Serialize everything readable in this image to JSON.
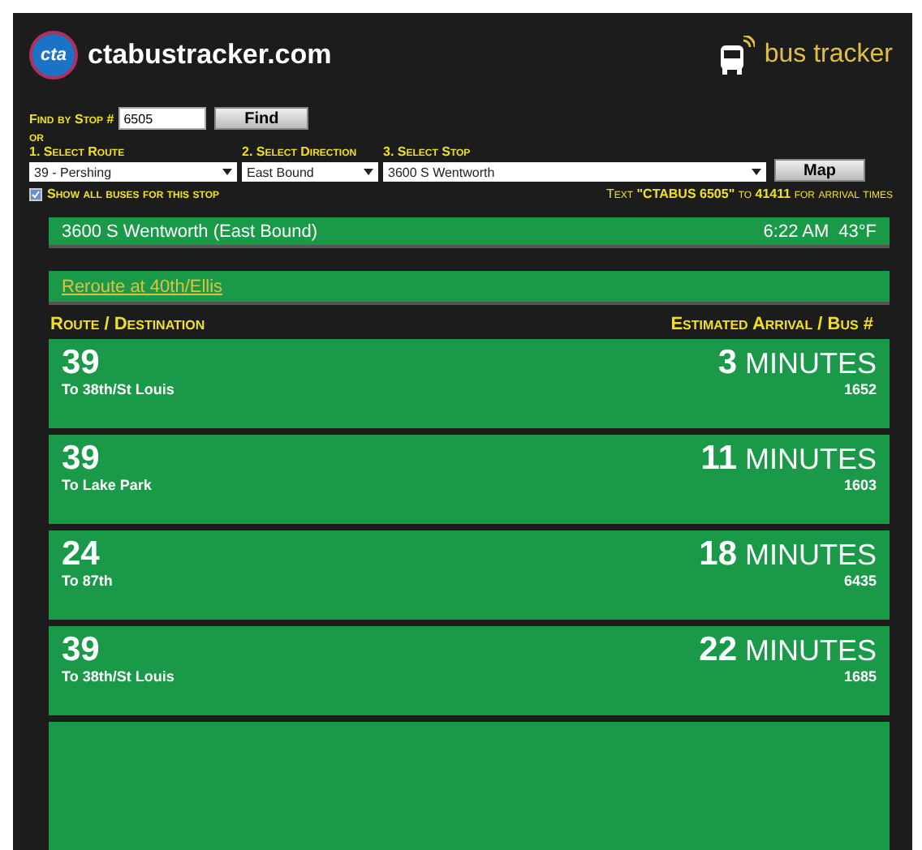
{
  "header": {
    "logo": "cta",
    "site": "ctabustracker.com",
    "brand": "bus tracker"
  },
  "find": {
    "label": "Find by Stop #",
    "value": "6505",
    "button": "Find"
  },
  "or": "or",
  "selects": [
    {
      "label": "1. Select Route",
      "value": "39 - Pershing"
    },
    {
      "label": "2. Select Direction",
      "value": "East Bound"
    },
    {
      "label": "3. Select Stop",
      "value": "3600 S Wentworth"
    }
  ],
  "map_button": "Map",
  "show_all": {
    "label": "Show all buses for this stop",
    "checked": true
  },
  "sms": "Text **\"CTABUS 6505\"** to **41411** for arrival times",
  "stop_bar": {
    "stop": "3600 S Wentworth (East Bound)",
    "time": "6:22 AM",
    "temp": "43°F"
  },
  "alert": "Reroute at 40th/Ellis",
  "columns": [
    "Route / Destination",
    "Estimated Arrival / Bus #"
  ],
  "arrivals": [
    {
      "route": "39",
      "destination": "To 38th/St Louis",
      "minutes": "3",
      "unit": "MINUTES",
      "bus": "1652"
    },
    {
      "route": "39",
      "destination": "To Lake Park",
      "minutes": "11",
      "unit": "MINUTES",
      "bus": "1603"
    },
    {
      "route": "24",
      "destination": "To 87th",
      "minutes": "18",
      "unit": "MINUTES",
      "bus": "6435"
    },
    {
      "route": "39",
      "destination": "To 38th/St Louis",
      "minutes": "22",
      "unit": "MINUTES",
      "bus": "1685"
    }
  ]
}
